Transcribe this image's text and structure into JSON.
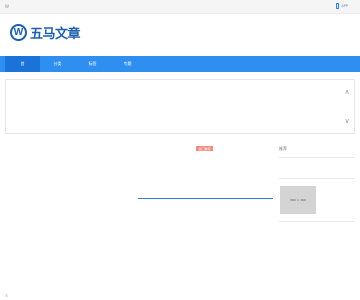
{
  "topbar": {
    "left_text": "W",
    "right_text": "APP"
  },
  "header": {
    "logo_mark": "W",
    "logo_text": "五马文章"
  },
  "nav": {
    "items": [
      "首",
      "分类",
      "标签",
      "专题"
    ]
  },
  "banner": {
    "arrow_up": "∧",
    "arrow_down": "∨"
  },
  "main": {
    "tag_label": "热门推荐"
  },
  "sidebar": {
    "title": "推荐",
    "ad_placeholder": "300 × 300"
  },
  "footer": {
    "text": "©"
  },
  "colors": {
    "nav_bg": "#2f8ff0",
    "nav_active": "#1a73d9",
    "brand": "#1f5fae",
    "tag_red": "#f28b7d"
  }
}
